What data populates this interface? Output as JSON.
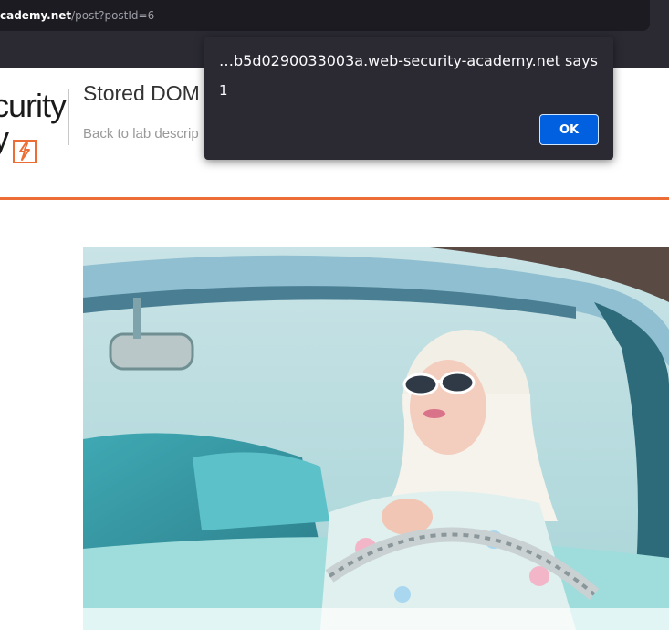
{
  "browser": {
    "url_domain": "cademy.net",
    "url_path": "/post?postId=6"
  },
  "header": {
    "logo_line1": "curity",
    "logo_line2": "y",
    "lab_title": "Stored DOM",
    "back_link": "Back to lab descrip"
  },
  "dialog": {
    "origin": "…b5d0290033003a.web-security-academy.net says",
    "message": "1",
    "ok_label": "OK"
  },
  "colors": {
    "accent_orange": "#ec6d35",
    "ok_blue": "#0060df",
    "dialog_bg": "#2b2a33"
  }
}
